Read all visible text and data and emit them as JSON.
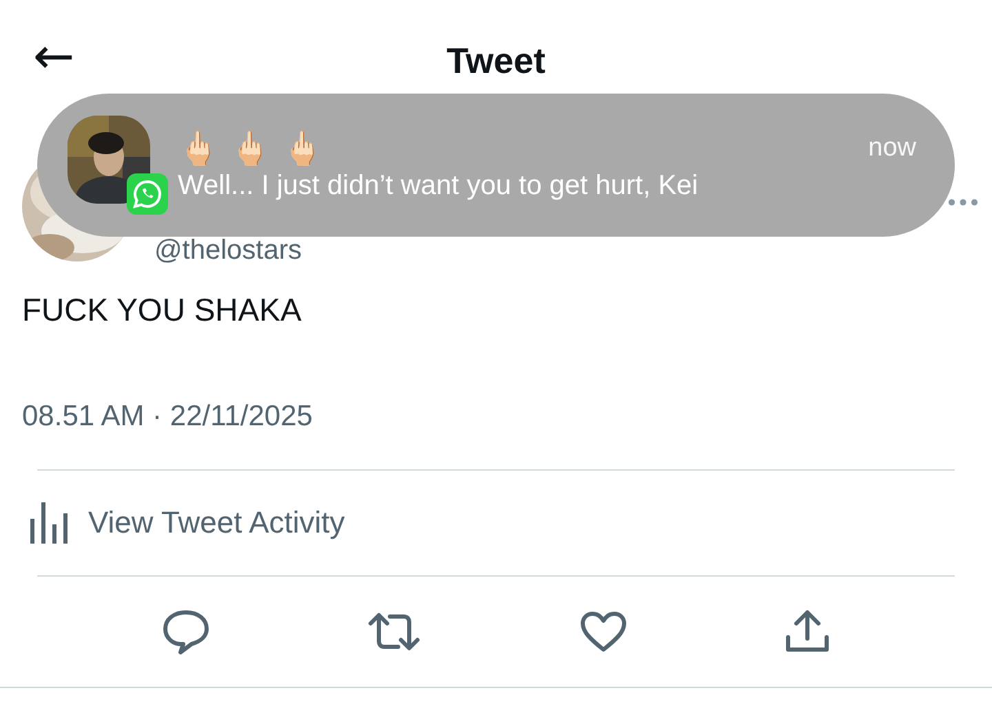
{
  "header": {
    "back": "←",
    "title": "Tweet"
  },
  "tweet": {
    "handle": "@thelostars",
    "text": "FUCK YOU SHAKA",
    "timestamp": "08.51 AM · 22/11/2025",
    "activity": "View Tweet Activity"
  },
  "notification": {
    "title": "🖕🏻 🖕🏻 🖕🏻",
    "time": "now",
    "message": "Well... I just didn’t want you to get hurt, Kei"
  }
}
